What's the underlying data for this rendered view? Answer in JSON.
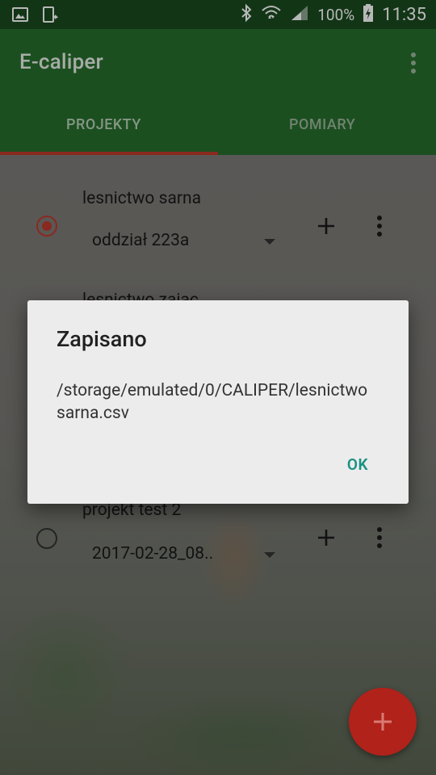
{
  "status_bar": {
    "battery": "100%",
    "time": "11:35"
  },
  "app": {
    "title": "E-caliper"
  },
  "tabs": [
    {
      "label": "PROJEKTY"
    },
    {
      "label": "POMIARY"
    }
  ],
  "projects": [
    {
      "name": "lesnictwo sarna",
      "spinner_value": "oddział 223a",
      "selected": true
    },
    {
      "name": "lesnictwo zajac",
      "spinner_value": "",
      "selected": false
    },
    {
      "name": "projekt test 2",
      "spinner_value": "2017-02-28_08..",
      "selected": false
    }
  ],
  "dialog": {
    "title": "Zapisano",
    "message": "/storage/emulated/0/CALIPER/lesnictwo sarna.csv",
    "ok_label": "OK"
  },
  "colors": {
    "app_bar": "#286e2d",
    "status_bar": "#194a1f",
    "accent": "#c0392b",
    "dialog_button": "#199182"
  }
}
